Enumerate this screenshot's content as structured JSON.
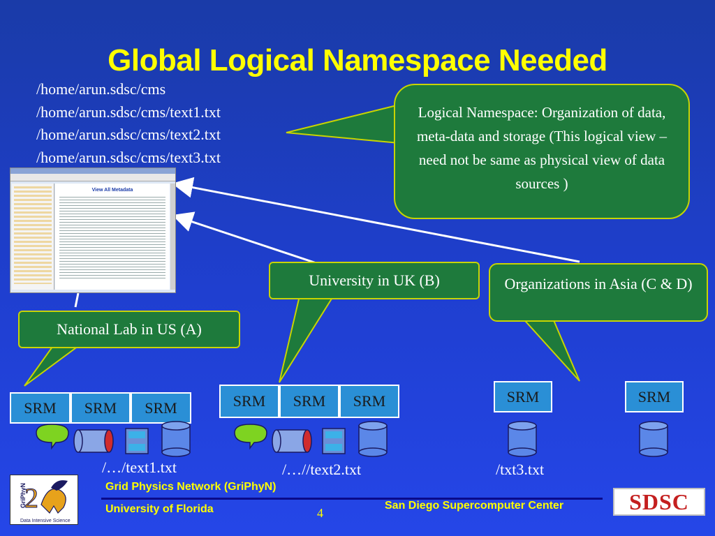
{
  "slide": {
    "title": "Global Logical Namespace Needed",
    "page_number": "4"
  },
  "paths": [
    "/home/arun.sdsc/cms",
    "/home/arun.sdsc/cms/text1.txt",
    "/home/arun.sdsc/cms/text2.txt",
    "/home/arun.sdsc/cms/text3.txt"
  ],
  "callouts": {
    "logical_namespace": "Logical  Namespace: Organization of data, meta-data and storage  (This logical view – need not be same as physical view of data sources )",
    "uk": "University in UK (B)",
    "asia": "Organizations in Asia (C & D)",
    "us": "National Lab in US (A)"
  },
  "srm_label": "SRM",
  "file_labels": {
    "a": "/…/text1.txt",
    "b": "/…//text2.txt",
    "c": "/txt3.txt"
  },
  "footer": {
    "griphyn": "Grid Physics Network (GriPhyN)",
    "uf": "University of Florida",
    "sdsc_center": "San Diego Supercomputer Center",
    "sdsc_logo": "SDSC",
    "griphyn_logo_text": "GriPhyN",
    "griphyn_logo_sub": "Data Intensive Science"
  },
  "screenshot": {
    "heading": "View All Metadata"
  },
  "colors": {
    "title": "#ffff00",
    "callout_fill": "#1e7a3c",
    "callout_border": "#c8d400",
    "srm_fill": "#2a8fd6",
    "arrow": "#ffffff"
  }
}
